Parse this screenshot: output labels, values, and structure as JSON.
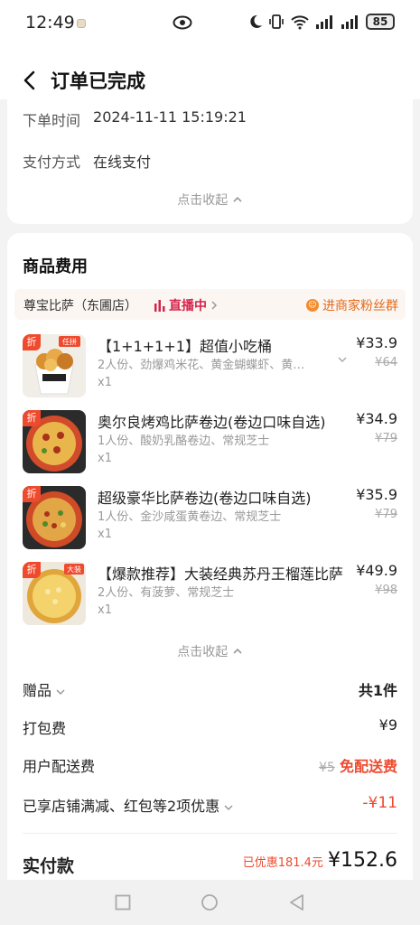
{
  "status_bar": {
    "time": "12:49",
    "battery": "85"
  },
  "nav": {
    "title": "订单已完成"
  },
  "order_info": {
    "order_time_label": "下单时间",
    "order_time_value": "2024-11-11 15:19:21",
    "payment_label": "支付方式",
    "payment_value": "在线支付",
    "collapse_label": "点击收起"
  },
  "goods": {
    "title": "商品费用",
    "shop_name": "尊宝比萨（东圃店）",
    "live_label": "直播中",
    "fans_label": "进商家粉丝群",
    "discount_tag": "折",
    "items": [
      {
        "name": "【1+1+1+1】超值小吃桶",
        "desc": "2人份、劲爆鸡米花、黄金蝴蝶虾、黄…",
        "qty": "x1",
        "price": "¥33.9",
        "orig_price": "¥64",
        "badge": "任拼"
      },
      {
        "name": "奥尔良烤鸡比萨卷边(卷边口味自选)",
        "desc": "1人份、酸奶乳酪卷边、常规芝士",
        "qty": "x1",
        "price": "¥34.9",
        "orig_price": "¥79"
      },
      {
        "name": "超级豪华比萨卷边(卷边口味自选)",
        "desc": "1人份、金沙咸蛋黄卷边、常规芝士",
        "qty": "x1",
        "price": "¥35.9",
        "orig_price": "¥79"
      },
      {
        "name": "【爆款推荐】大装经典苏丹王榴莲比萨",
        "desc": "2人份、有菠萝、常规芝士",
        "qty": "x1",
        "price": "¥49.9",
        "orig_price": "¥98",
        "badge": "大装"
      }
    ],
    "collapse_label": "点击收起",
    "gift_label": "赠品",
    "gift_value": "共1件",
    "packing_label": "打包费",
    "packing_value": "¥9",
    "delivery_label": "用户配送费",
    "delivery_orig": "¥5",
    "delivery_value": "免配送费",
    "discount_label": "已享店铺满减、红包等2项优惠",
    "discount_value": "-¥11",
    "total_label": "实付款",
    "saved_label": "已优惠181.4元",
    "total_value": "¥152.6"
  },
  "colors": {
    "accent_red": "#ee4a2e",
    "live_pink": "#d4244c",
    "fans_orange": "#e46a1b"
  }
}
